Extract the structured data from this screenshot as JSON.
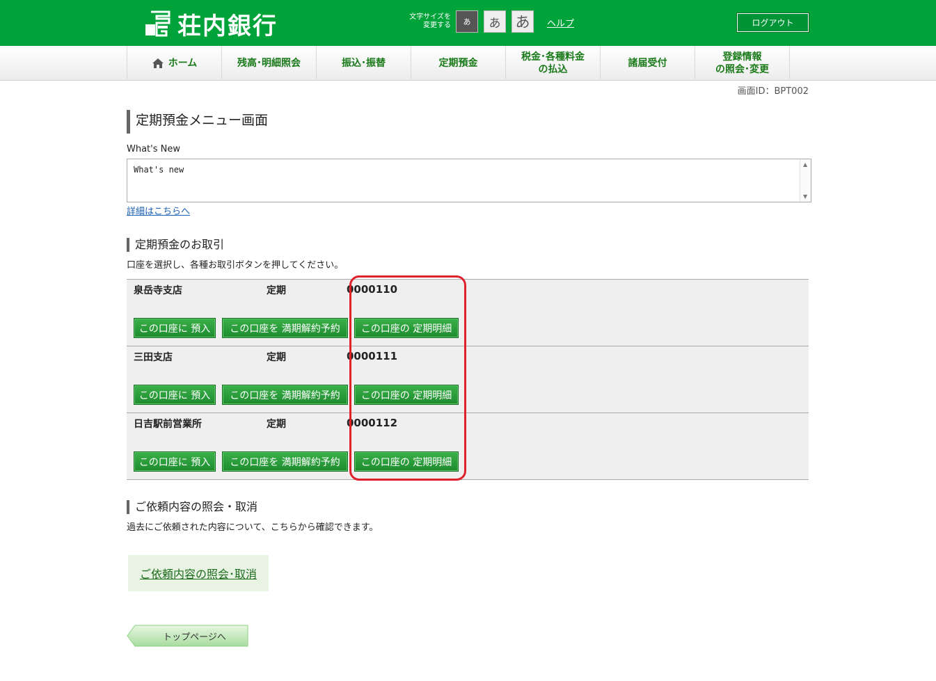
{
  "header": {
    "bank_name": "荘内銀行",
    "fontsize_label": "文字サイズを\n変更する",
    "fs_small": "あ",
    "fs_mid": "あ",
    "fs_large": "あ",
    "help": "ヘルプ",
    "logout": "ログアウト"
  },
  "nav": {
    "items": [
      {
        "label": "ホーム"
      },
      {
        "label": "残高･明細照会"
      },
      {
        "label": "振込･振替"
      },
      {
        "label": "定期預金"
      },
      {
        "label": "税金･各種料金\nの払込"
      },
      {
        "label": "諸届受付"
      },
      {
        "label": "登録情報\nの照会･変更"
      }
    ]
  },
  "screen_id": "画面ID：BPT002",
  "page_title": "定期預金メニュー画面",
  "whatsnew": {
    "label": "What's New",
    "content": "What's new",
    "detail_link": "詳細はこちらへ"
  },
  "transactions": {
    "title": "定期預金のお取引",
    "instruction": "口座を選択し、各種お取引ボタンを押してください。",
    "accounts": [
      {
        "branch": "泉岳寺支店",
        "type": "定期",
        "number": "0000110"
      },
      {
        "branch": "三田支店",
        "type": "定期",
        "number": "0000111"
      },
      {
        "branch": "日吉駅前営業所",
        "type": "定期",
        "number": "0000112"
      }
    ],
    "buttons": {
      "deposit": "この口座に 預入",
      "cancel": "この口座を 満期解約予約",
      "statement": "この口座の 定期明細"
    }
  },
  "requests": {
    "title": "ご依頼内容の照会・取消",
    "description": "過去にご依頼された内容について、こちらから確認できます。",
    "link": "ご依頼内容の照会･取消"
  },
  "top_page": "トップページへ",
  "colors": {
    "header_green": "#00a33a",
    "button_green": "#1f8c2e",
    "highlight_red": "#e0202a"
  }
}
